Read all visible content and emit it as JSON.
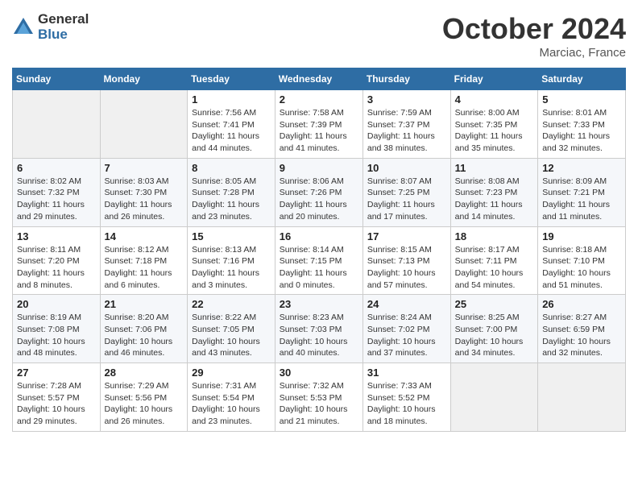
{
  "header": {
    "logo_general": "General",
    "logo_blue": "Blue",
    "month_title": "October 2024",
    "location": "Marciac, France"
  },
  "weekdays": [
    "Sunday",
    "Monday",
    "Tuesday",
    "Wednesday",
    "Thursday",
    "Friday",
    "Saturday"
  ],
  "weeks": [
    [
      {
        "day": "",
        "sunrise": "",
        "sunset": "",
        "daylight": ""
      },
      {
        "day": "",
        "sunrise": "",
        "sunset": "",
        "daylight": ""
      },
      {
        "day": "1",
        "sunrise": "Sunrise: 7:56 AM",
        "sunset": "Sunset: 7:41 PM",
        "daylight": "Daylight: 11 hours and 44 minutes."
      },
      {
        "day": "2",
        "sunrise": "Sunrise: 7:58 AM",
        "sunset": "Sunset: 7:39 PM",
        "daylight": "Daylight: 11 hours and 41 minutes."
      },
      {
        "day": "3",
        "sunrise": "Sunrise: 7:59 AM",
        "sunset": "Sunset: 7:37 PM",
        "daylight": "Daylight: 11 hours and 38 minutes."
      },
      {
        "day": "4",
        "sunrise": "Sunrise: 8:00 AM",
        "sunset": "Sunset: 7:35 PM",
        "daylight": "Daylight: 11 hours and 35 minutes."
      },
      {
        "day": "5",
        "sunrise": "Sunrise: 8:01 AM",
        "sunset": "Sunset: 7:33 PM",
        "daylight": "Daylight: 11 hours and 32 minutes."
      }
    ],
    [
      {
        "day": "6",
        "sunrise": "Sunrise: 8:02 AM",
        "sunset": "Sunset: 7:32 PM",
        "daylight": "Daylight: 11 hours and 29 minutes."
      },
      {
        "day": "7",
        "sunrise": "Sunrise: 8:03 AM",
        "sunset": "Sunset: 7:30 PM",
        "daylight": "Daylight: 11 hours and 26 minutes."
      },
      {
        "day": "8",
        "sunrise": "Sunrise: 8:05 AM",
        "sunset": "Sunset: 7:28 PM",
        "daylight": "Daylight: 11 hours and 23 minutes."
      },
      {
        "day": "9",
        "sunrise": "Sunrise: 8:06 AM",
        "sunset": "Sunset: 7:26 PM",
        "daylight": "Daylight: 11 hours and 20 minutes."
      },
      {
        "day": "10",
        "sunrise": "Sunrise: 8:07 AM",
        "sunset": "Sunset: 7:25 PM",
        "daylight": "Daylight: 11 hours and 17 minutes."
      },
      {
        "day": "11",
        "sunrise": "Sunrise: 8:08 AM",
        "sunset": "Sunset: 7:23 PM",
        "daylight": "Daylight: 11 hours and 14 minutes."
      },
      {
        "day": "12",
        "sunrise": "Sunrise: 8:09 AM",
        "sunset": "Sunset: 7:21 PM",
        "daylight": "Daylight: 11 hours and 11 minutes."
      }
    ],
    [
      {
        "day": "13",
        "sunrise": "Sunrise: 8:11 AM",
        "sunset": "Sunset: 7:20 PM",
        "daylight": "Daylight: 11 hours and 8 minutes."
      },
      {
        "day": "14",
        "sunrise": "Sunrise: 8:12 AM",
        "sunset": "Sunset: 7:18 PM",
        "daylight": "Daylight: 11 hours and 6 minutes."
      },
      {
        "day": "15",
        "sunrise": "Sunrise: 8:13 AM",
        "sunset": "Sunset: 7:16 PM",
        "daylight": "Daylight: 11 hours and 3 minutes."
      },
      {
        "day": "16",
        "sunrise": "Sunrise: 8:14 AM",
        "sunset": "Sunset: 7:15 PM",
        "daylight": "Daylight: 11 hours and 0 minutes."
      },
      {
        "day": "17",
        "sunrise": "Sunrise: 8:15 AM",
        "sunset": "Sunset: 7:13 PM",
        "daylight": "Daylight: 10 hours and 57 minutes."
      },
      {
        "day": "18",
        "sunrise": "Sunrise: 8:17 AM",
        "sunset": "Sunset: 7:11 PM",
        "daylight": "Daylight: 10 hours and 54 minutes."
      },
      {
        "day": "19",
        "sunrise": "Sunrise: 8:18 AM",
        "sunset": "Sunset: 7:10 PM",
        "daylight": "Daylight: 10 hours and 51 minutes."
      }
    ],
    [
      {
        "day": "20",
        "sunrise": "Sunrise: 8:19 AM",
        "sunset": "Sunset: 7:08 PM",
        "daylight": "Daylight: 10 hours and 48 minutes."
      },
      {
        "day": "21",
        "sunrise": "Sunrise: 8:20 AM",
        "sunset": "Sunset: 7:06 PM",
        "daylight": "Daylight: 10 hours and 46 minutes."
      },
      {
        "day": "22",
        "sunrise": "Sunrise: 8:22 AM",
        "sunset": "Sunset: 7:05 PM",
        "daylight": "Daylight: 10 hours and 43 minutes."
      },
      {
        "day": "23",
        "sunrise": "Sunrise: 8:23 AM",
        "sunset": "Sunset: 7:03 PM",
        "daylight": "Daylight: 10 hours and 40 minutes."
      },
      {
        "day": "24",
        "sunrise": "Sunrise: 8:24 AM",
        "sunset": "Sunset: 7:02 PM",
        "daylight": "Daylight: 10 hours and 37 minutes."
      },
      {
        "day": "25",
        "sunrise": "Sunrise: 8:25 AM",
        "sunset": "Sunset: 7:00 PM",
        "daylight": "Daylight: 10 hours and 34 minutes."
      },
      {
        "day": "26",
        "sunrise": "Sunrise: 8:27 AM",
        "sunset": "Sunset: 6:59 PM",
        "daylight": "Daylight: 10 hours and 32 minutes."
      }
    ],
    [
      {
        "day": "27",
        "sunrise": "Sunrise: 7:28 AM",
        "sunset": "Sunset: 5:57 PM",
        "daylight": "Daylight: 10 hours and 29 minutes."
      },
      {
        "day": "28",
        "sunrise": "Sunrise: 7:29 AM",
        "sunset": "Sunset: 5:56 PM",
        "daylight": "Daylight: 10 hours and 26 minutes."
      },
      {
        "day": "29",
        "sunrise": "Sunrise: 7:31 AM",
        "sunset": "Sunset: 5:54 PM",
        "daylight": "Daylight: 10 hours and 23 minutes."
      },
      {
        "day": "30",
        "sunrise": "Sunrise: 7:32 AM",
        "sunset": "Sunset: 5:53 PM",
        "daylight": "Daylight: 10 hours and 21 minutes."
      },
      {
        "day": "31",
        "sunrise": "Sunrise: 7:33 AM",
        "sunset": "Sunset: 5:52 PM",
        "daylight": "Daylight: 10 hours and 18 minutes."
      },
      {
        "day": "",
        "sunrise": "",
        "sunset": "",
        "daylight": ""
      },
      {
        "day": "",
        "sunrise": "",
        "sunset": "",
        "daylight": ""
      }
    ]
  ]
}
